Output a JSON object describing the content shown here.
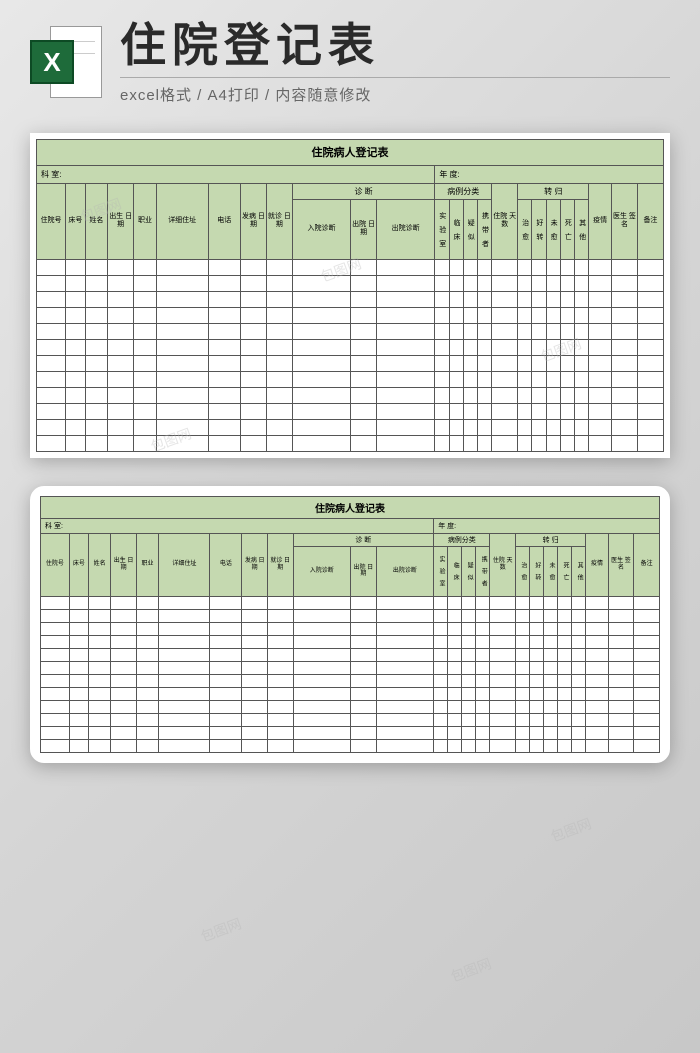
{
  "header": {
    "icon_letter": "X",
    "title": "住院登记表",
    "subtitle": "excel格式 / A4打印 / 内容随意修改"
  },
  "form": {
    "title": "住院病人登记表",
    "info_left_label": "科    室:",
    "info_right_label": "年    度:",
    "groups": {
      "diagnosis": "诊        断",
      "case_type": "病例分类",
      "outcome": "转        归"
    },
    "cols": {
      "c1": "住院号",
      "c2": "床号",
      "c3": "姓名",
      "c4": "出生\n日期",
      "c5": "职业",
      "c6": "详细住址",
      "c7": "电话",
      "c8": "发病\n日期",
      "c9": "就诊\n日期",
      "d1": "入院诊断",
      "d2": "出院\n日期",
      "d3": "出院诊断",
      "t1": "实\n验\n室",
      "t2": "临\n床",
      "t3": "疑\n似",
      "t4": "携\n带\n者",
      "c10": "住院\n天数",
      "o1": "治\n愈",
      "o2": "好\n转",
      "o3": "未\n愈",
      "o4": "死\n亡",
      "o5": "其\n他",
      "c11": "疫情",
      "c12": "医生\n签名",
      "c13": "备注"
    }
  },
  "watermark": "包图网"
}
